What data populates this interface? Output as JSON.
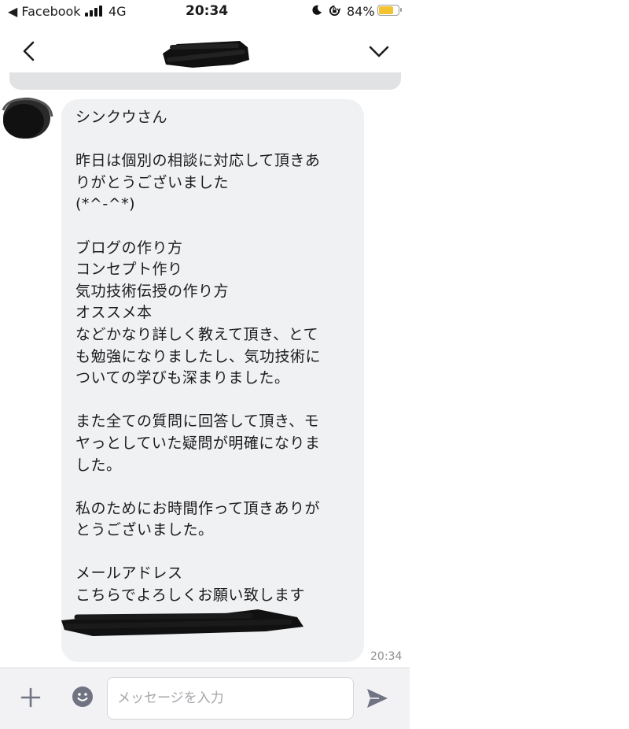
{
  "status_bar": {
    "back_label": "◀ Facebook",
    "network": "4G",
    "time": "20:34",
    "battery_percent": "84%",
    "battery_level": 0.84
  },
  "chat": {
    "message_text": "シンクウさん\n\n昨日は個別の相談に対応して頂きあ\nりがとうございました\n(*^-^*)\n\nブログの作り方\nコンセプト作り\n気功技術伝授の作り方\nオススメ本\nなどかなり詳しく教えて頂き、とて\nも勉強になりましたし、気功技術に\nついての学びも深まりました。\n\nまた全ての質問に回答して頂き、モ\nヤっとしていた疑問が明確になりま\nした。\n\n私のためにお時間作って頂きありが\nとうございました。\n\nメールアドレス\nこちらでよろしくお願い致します",
    "message_time": "20:34"
  },
  "input_bar": {
    "placeholder": "メッセージを入力",
    "value": ""
  },
  "icons": {
    "back": "chevron-left-icon",
    "menu": "chevron-down-icon",
    "plus": "plus-icon",
    "emoji": "smiley-icon",
    "send": "send-icon"
  },
  "colors": {
    "bubble": "#f0f1f3",
    "battery": "#f4c430",
    "icon": "#6f7382"
  }
}
